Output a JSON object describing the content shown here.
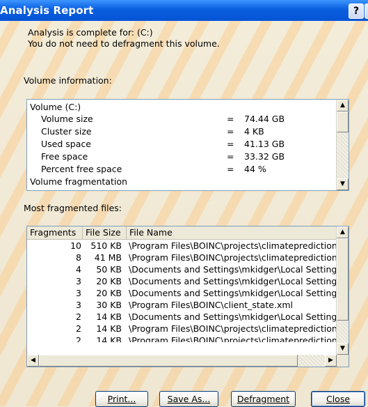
{
  "window": {
    "title": "Analysis Report",
    "help_glyph": "?",
    "close_glyph": "×"
  },
  "message": {
    "line1": "Analysis is complete for: (C:)",
    "line2": "You do not need to defragment this volume."
  },
  "volume_info": {
    "label": "Volume information:",
    "rows": [
      {
        "key": "Volume  (C:)",
        "eq": "",
        "value": ""
      },
      {
        "key": "Volume size",
        "eq": "=",
        "value": "74.44 GB"
      },
      {
        "key": "Cluster size",
        "eq": "=",
        "value": "4 KB"
      },
      {
        "key": "Used space",
        "eq": "=",
        "value": "41.13 GB"
      },
      {
        "key": "Free space",
        "eq": "=",
        "value": "33.32 GB"
      },
      {
        "key": "Percent free space",
        "eq": "=",
        "value": "44 %"
      },
      {
        "key": "Volume fragmentation",
        "eq": "",
        "value": ""
      }
    ]
  },
  "files": {
    "label": "Most fragmented files:",
    "columns": [
      "Fragments",
      "File Size",
      "File Name"
    ],
    "rows": [
      {
        "fragments": "10",
        "size": "510 KB",
        "name": "\\Program Files\\BOINC\\projects\\climateprediction.net\\"
      },
      {
        "fragments": "8",
        "size": "41 MB",
        "name": "\\Program Files\\BOINC\\projects\\climateprediction.net\\"
      },
      {
        "fragments": "4",
        "size": "50 KB",
        "name": "\\Documents and Settings\\mkidger\\Local Settings\\Te"
      },
      {
        "fragments": "3",
        "size": "20 KB",
        "name": "\\Documents and Settings\\mkidger\\Local Settings\\Te"
      },
      {
        "fragments": "3",
        "size": "20 KB",
        "name": "\\Documents and Settings\\mkidger\\Local Settings\\Te"
      },
      {
        "fragments": "3",
        "size": "30 KB",
        "name": "\\Program Files\\BOINC\\client_state.xml"
      },
      {
        "fragments": "2",
        "size": "14 KB",
        "name": "\\Documents and Settings\\mkidger\\Local Settings\\Te"
      },
      {
        "fragments": "2",
        "size": "14 KB",
        "name": "\\Program Files\\BOINC\\projects\\climateprediction.net\\"
      },
      {
        "fragments": "2",
        "size": "14 KB",
        "name": "\\Program Files\\BOINC\\projects\\climateprediction.net\\"
      }
    ]
  },
  "buttons": {
    "print": "Print...",
    "save_as": "Save As...",
    "defragment": "Defragment",
    "close": "Close"
  },
  "icons": {
    "scroll_up": "▲",
    "scroll_down": "▼",
    "scroll_left": "◀",
    "scroll_right": "▶"
  }
}
